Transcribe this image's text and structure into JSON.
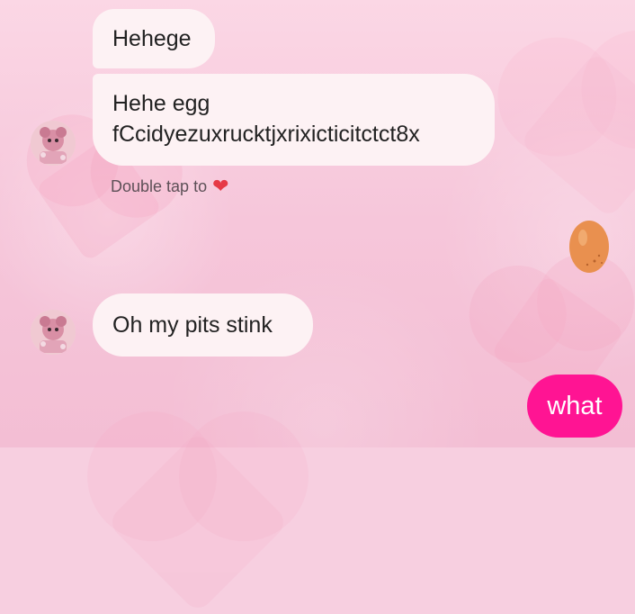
{
  "messages": [
    {
      "text": "Hehege"
    },
    {
      "line1": "Hehe egg",
      "line2": "fCcidyezuxrucktjxrixicticitctct8x"
    },
    {
      "text": "Oh my pits stink"
    }
  ],
  "reaction_hint": {
    "text": "Double tap to",
    "icon": "heart-icon"
  },
  "sent_message": {
    "text": "what"
  },
  "sticker": {
    "icon": "egg-icon"
  },
  "colors": {
    "sent_bubble": "#ff1493",
    "received_bubble": "#fdf2f4",
    "background": "#f7cfe0",
    "heart": "#e63946",
    "egg": "#e9904f"
  }
}
